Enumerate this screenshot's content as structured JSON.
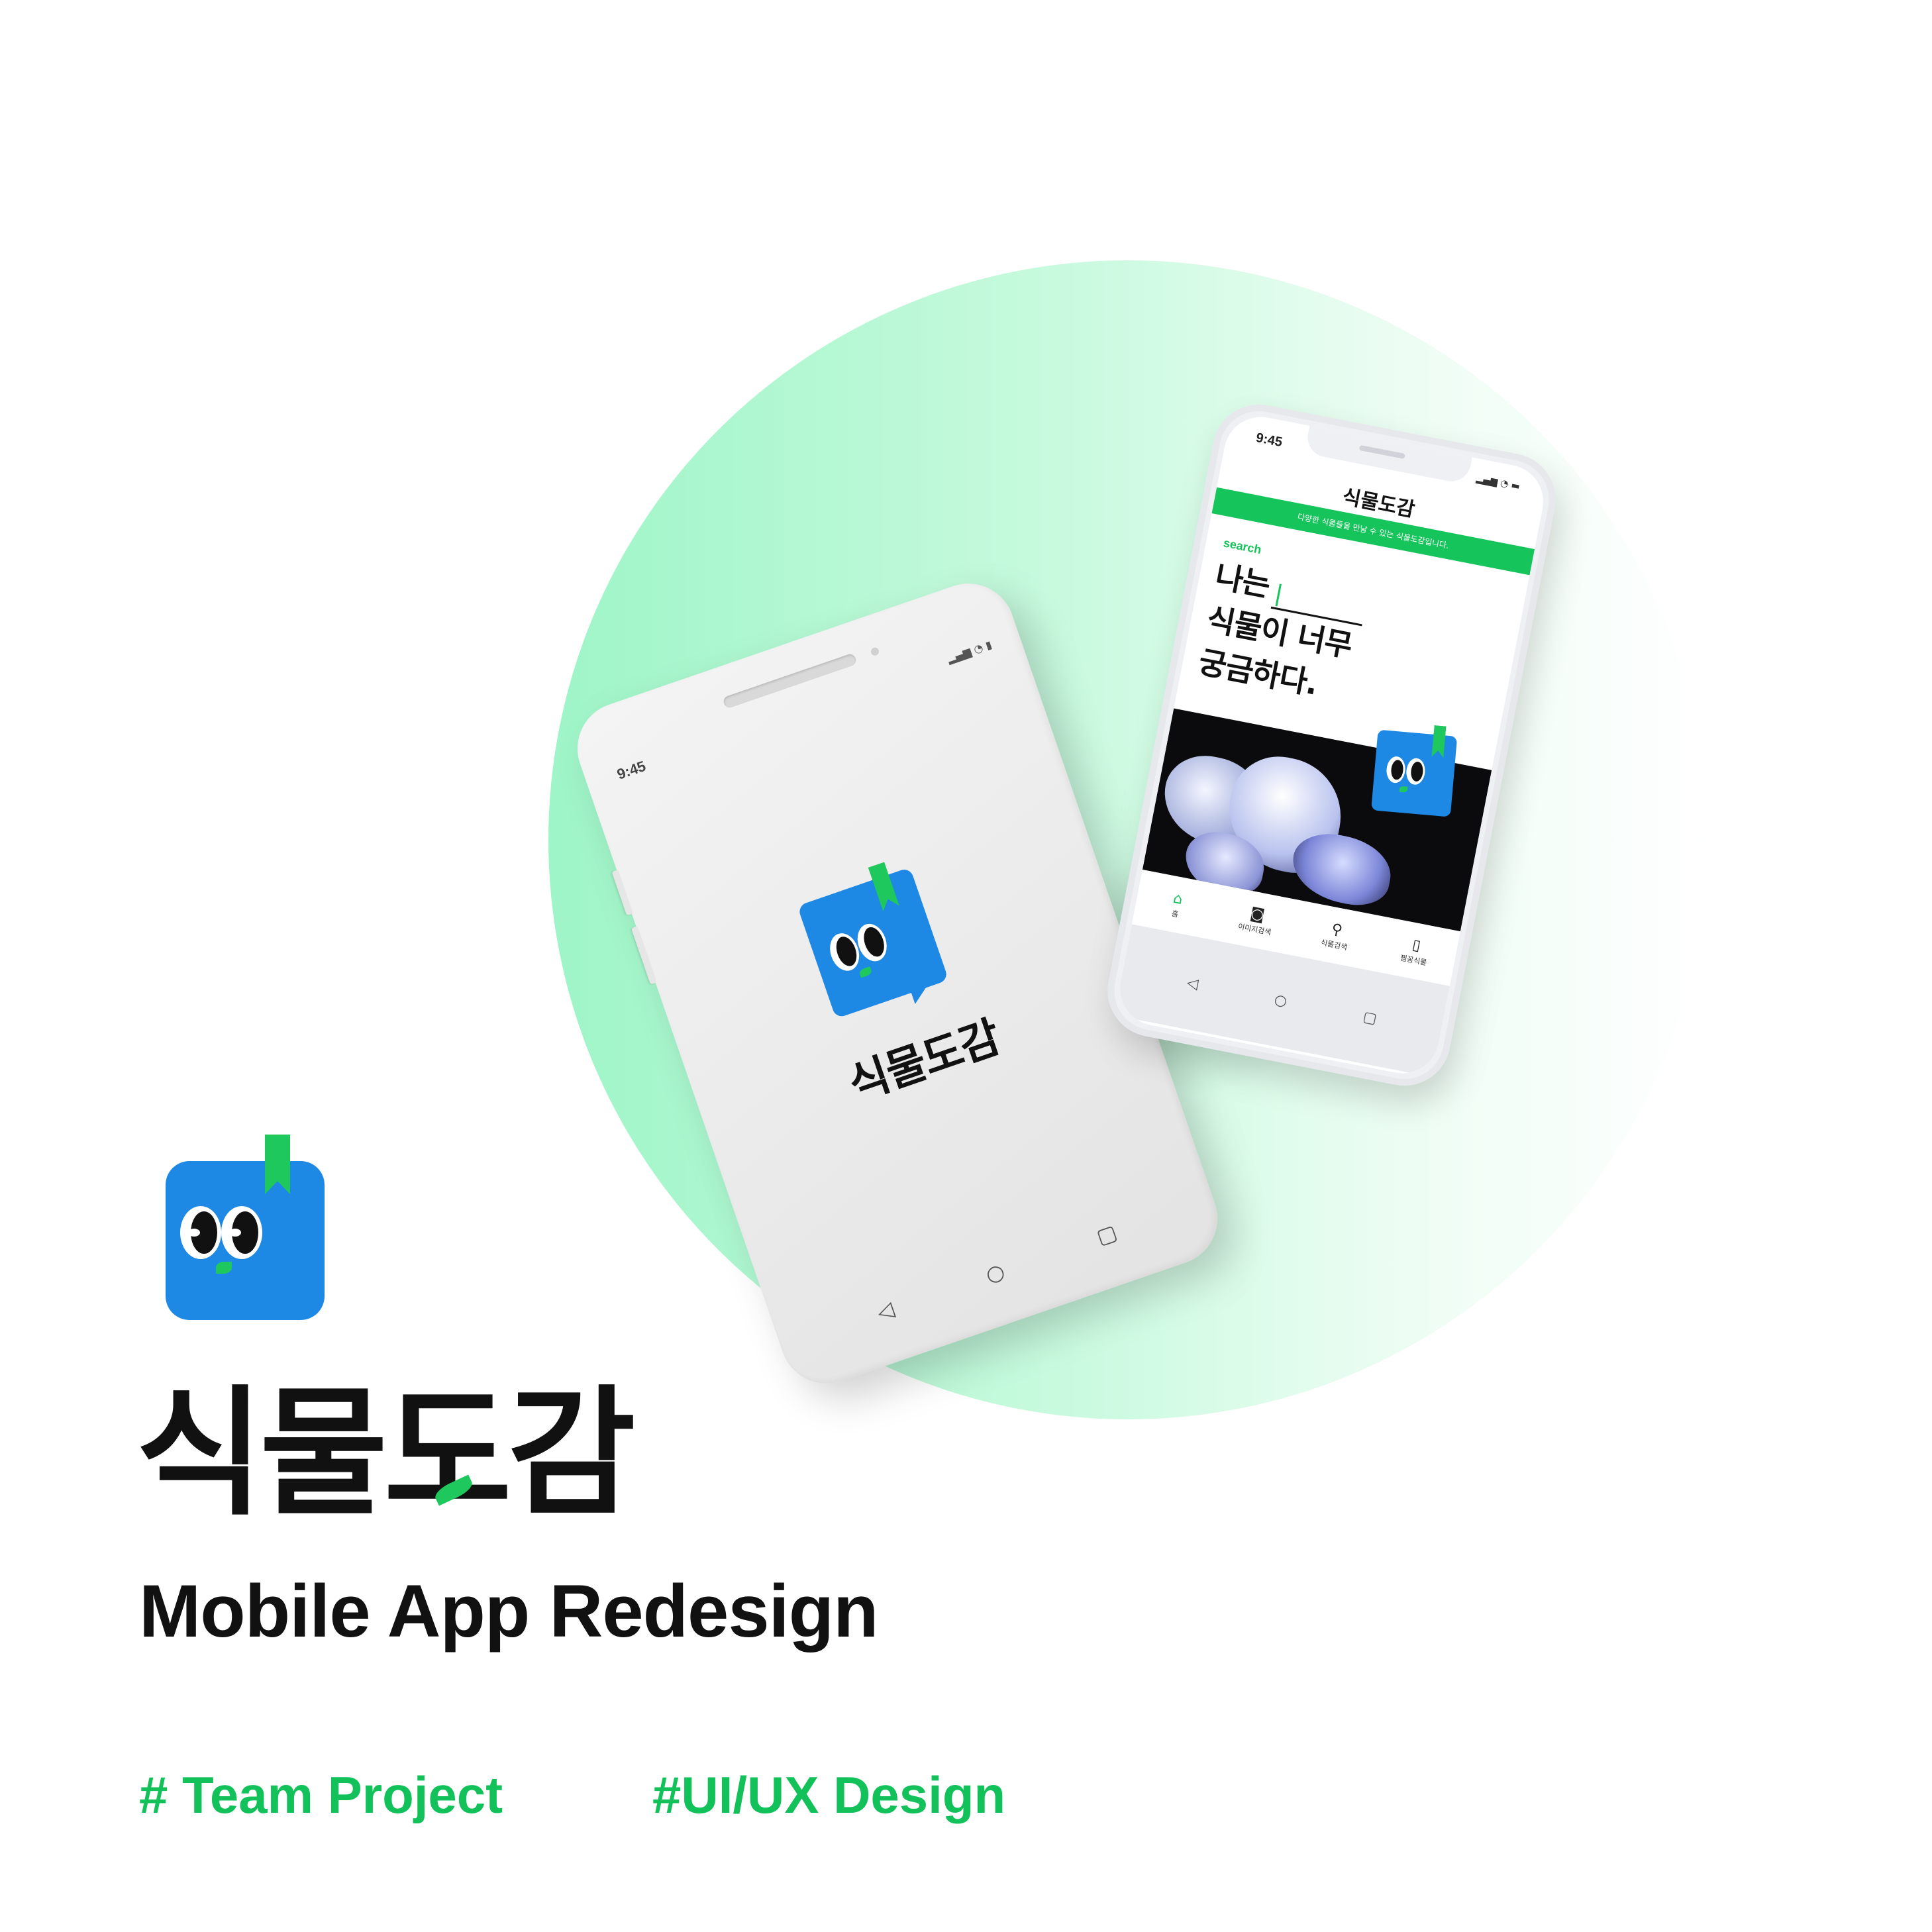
{
  "brand": {
    "name_kr": "식물도감",
    "subtitle": "Mobile App Redesign",
    "tags": [
      "# Team Project",
      "#UI/UX Design"
    ],
    "colors": {
      "green": "#12c15a",
      "blue": "#1e88e5",
      "mint": "#9ef5c7"
    }
  },
  "phone_android": {
    "time": "9:45",
    "status_icons": "▂▄▆ ◔ ▮",
    "wordmark": "식물도감",
    "nav": {
      "back": "◁",
      "home": "○",
      "recent": "▢"
    }
  },
  "phone_iphone": {
    "time": "9:45",
    "status_icons": "▂▄▆ ◔ ▬",
    "app_title": "식물도감",
    "banner": "다양한 식물들을 만날 수 있는 식물도감입니다.",
    "search_label": "search",
    "headline": {
      "line1": "나는",
      "line2": "식물이 너무",
      "line3": "궁금하다."
    },
    "tabs": [
      {
        "icon": "⌂",
        "label": "홈"
      },
      {
        "icon": "◙",
        "label": "이미지검색"
      },
      {
        "icon": "⚲",
        "label": "식물검색"
      },
      {
        "icon": "▯",
        "label": "찜꽁식물"
      }
    ],
    "nav": {
      "back": "◁",
      "home": "○",
      "recent": "▢"
    }
  }
}
